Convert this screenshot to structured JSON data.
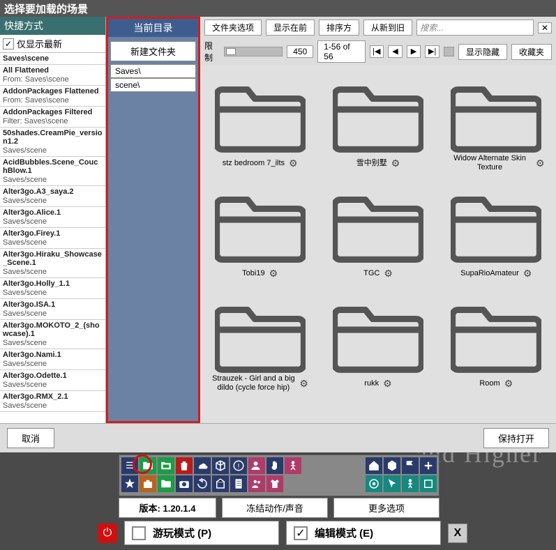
{
  "title": "选择要加载的场景",
  "shortcuts": {
    "header": "快捷方式",
    "only_show_newest": "仅显示最新",
    "items": [
      {
        "name": "Saves\\scene",
        "path": ""
      },
      {
        "name": "All Flattened",
        "label": "From:",
        "path": "Saves\\scene"
      },
      {
        "name": "AddonPackages Flattened",
        "label": "From:",
        "path": "Saves\\scene"
      },
      {
        "name": "AddonPackages Filtered",
        "label": "Filter:",
        "path": "Saves\\scene"
      },
      {
        "name": "50shades.CreamPie_version1.2",
        "path": "Saves/scene"
      },
      {
        "name": "AcidBubbles.Scene_CouchBlow.1",
        "path": "Saves/scene"
      },
      {
        "name": "Alter3go.A3_saya.2",
        "path": "Saves/scene"
      },
      {
        "name": "Alter3go.Alice.1",
        "path": "Saves/scene"
      },
      {
        "name": "Alter3go.Firey.1",
        "path": "Saves/scene"
      },
      {
        "name": "Alter3go.Hiraku_Showcase_Scene.1",
        "path": "Saves/scene"
      },
      {
        "name": "Alter3go.Holly_1.1",
        "path": "Saves/scene"
      },
      {
        "name": "Alter3go.ISA.1",
        "path": "Saves/scene"
      },
      {
        "name": "Alter3go.MOKOTO_2_(showcase).1",
        "path": "Saves/scene"
      },
      {
        "name": "Alter3go.Nami.1",
        "path": "Saves/scene"
      },
      {
        "name": "Alter3go.Odette.1",
        "path": "Saves/scene"
      },
      {
        "name": "Alter3go.RMX_2.1",
        "path": "Saves/scene"
      }
    ]
  },
  "curdir": {
    "header": "当前目录",
    "new_folder": "新建文件夹",
    "entries": [
      "Saves\\",
      "scene\\"
    ]
  },
  "browser": {
    "toolbar": {
      "folder_opts": "文件夹选项",
      "show_before": "显示在前",
      "sort_by": "排序方",
      "sort_newest": "从新到旧",
      "search_placeholder": "搜索...",
      "limit_label": "限制",
      "limit_value": "450",
      "range": "1-56 of 56",
      "show_hidden": "显示隐藏",
      "favorites": "收藏夹"
    },
    "tiles": [
      {
        "label": "stz bedroom 7_ilts"
      },
      {
        "label": "雪中别墅"
      },
      {
        "label": "Widow Alternate Skin Texture"
      },
      {
        "label": "Tobi19"
      },
      {
        "label": "TGC"
      },
      {
        "label": "SupaRioAmateur"
      },
      {
        "label": "Strauzek - Girl and a big dildo (cycle force hip)"
      },
      {
        "label": "rukk"
      },
      {
        "label": "Room"
      }
    ]
  },
  "footer": {
    "cancel": "取消",
    "keep_open": "保持打开"
  },
  "bottom": {
    "version": "版本: 1.20.1.4",
    "freeze": "冻结动作/声音",
    "more_opts": "更多选项",
    "play_mode": "游玩模式 (P)",
    "edit_mode": "编辑模式 (E)"
  },
  "bg_text": "and Higher"
}
